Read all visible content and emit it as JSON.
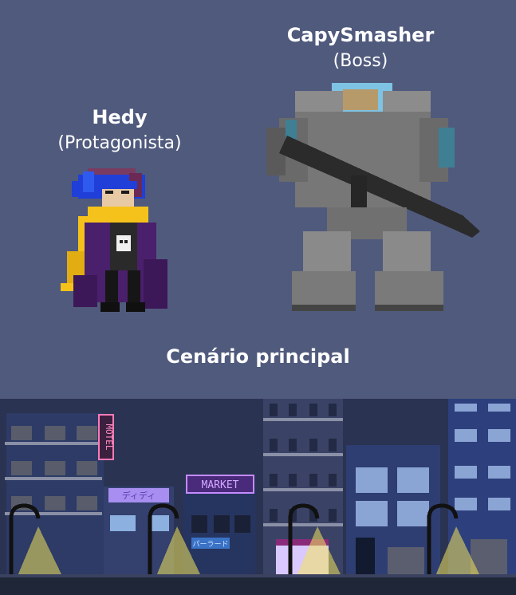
{
  "characters": {
    "hero": {
      "name": "Hedy",
      "role": "(Protagonista)"
    },
    "boss": {
      "name": "CapySmasher",
      "role": "(Boss)"
    }
  },
  "scene": {
    "title": "Cenário principal",
    "signs": {
      "motel": "MOTEL",
      "market": "MARKET",
      "shop_jp": "ディディ",
      "hotel_jp": "パーラード"
    }
  },
  "colors": {
    "background": "#505a7d",
    "night_sky": "#2a3352",
    "building_blue": "#2d3b66",
    "lamp_light": "#f2e35b",
    "scarf": "#f5c21b",
    "cloak": "#4a1f6b",
    "hair": "#1f3fd8",
    "armor": "#8a8a8a",
    "visor": "#7ec3e3"
  },
  "icons": [
    "hero-sprite",
    "boss-sprite",
    "city-scene"
  ]
}
